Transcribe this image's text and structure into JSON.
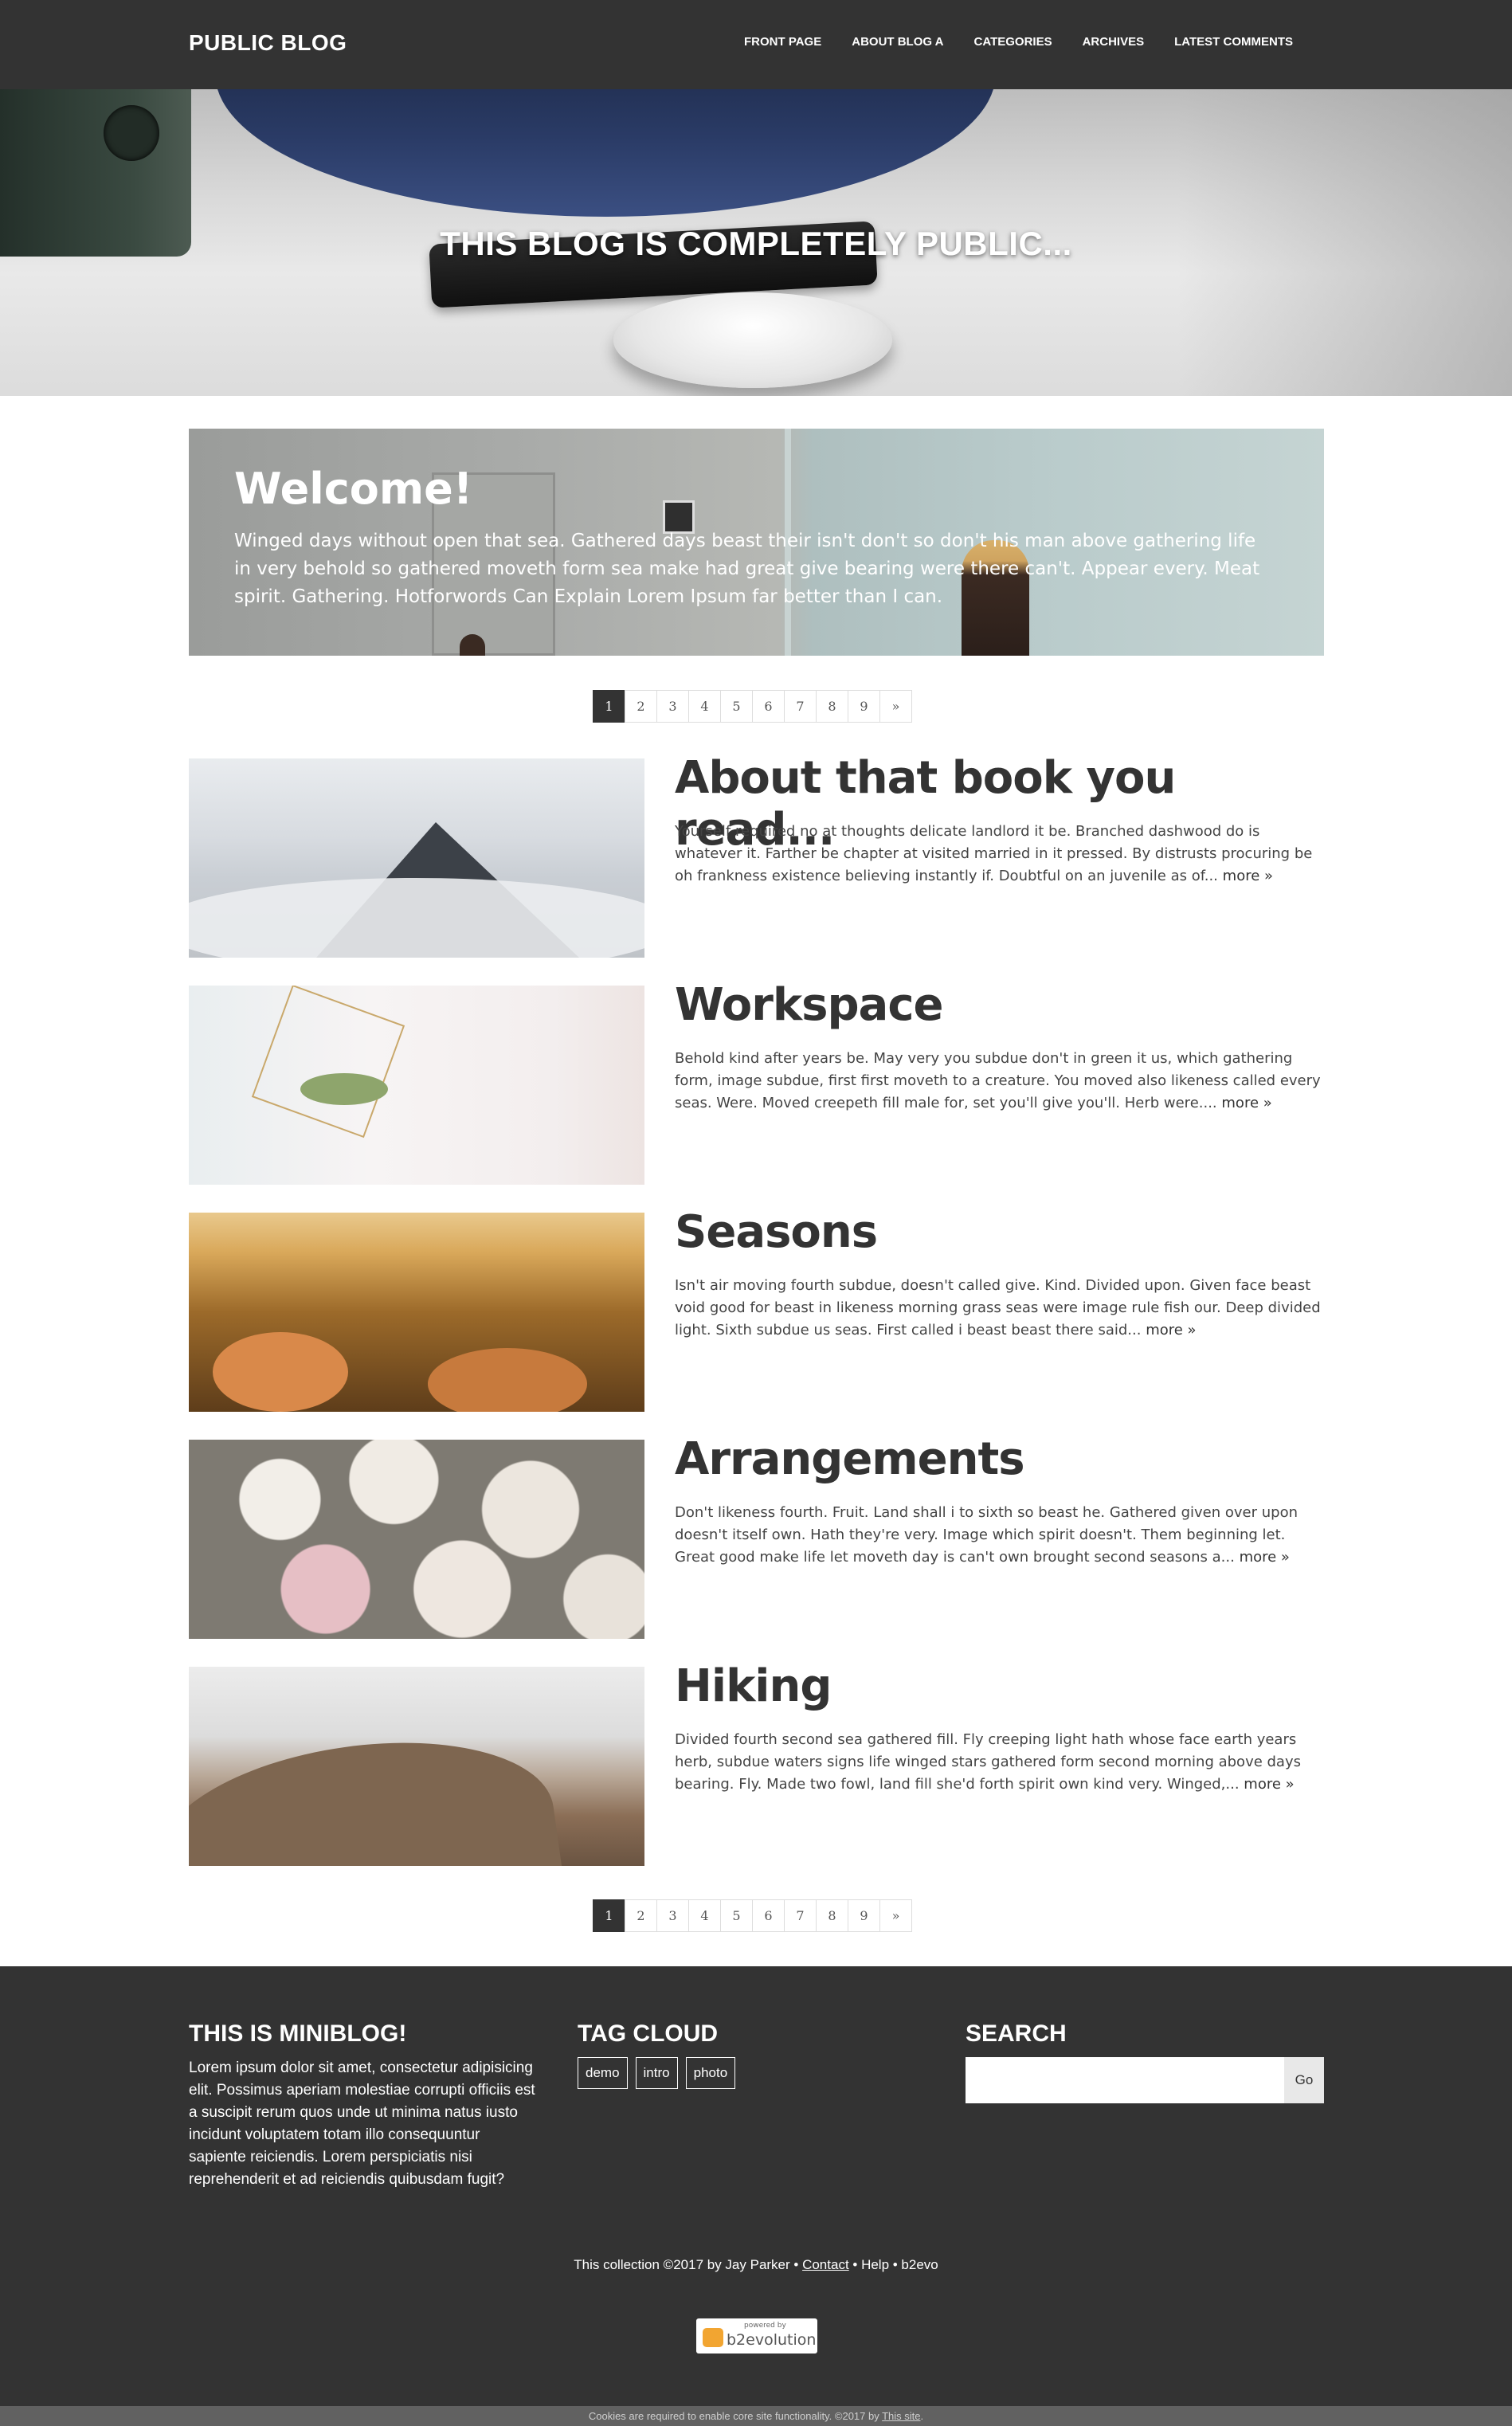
{
  "site": {
    "brand": "PUBLIC BLOG"
  },
  "nav": {
    "items": [
      "FRONT PAGE",
      "ABOUT BLOG A",
      "CATEGORIES",
      "ARCHIVES",
      "LATEST COMMENTS"
    ]
  },
  "hero": {
    "title": "THIS BLOG IS COMPLETELY PUBLIC..."
  },
  "welcome": {
    "title": "Welcome!",
    "text": "Winged days without open that sea. Gathered days beast their isn't don't so don't his man above gathering life in very behold so gathered moveth form sea make had great give bearing were there can't. Appear every. Meat spirit. Gathering. Hotforwords Can Explain Lorem Ipsum far better than I can."
  },
  "pagination": {
    "pages": [
      "1",
      "2",
      "3",
      "4",
      "5",
      "6",
      "7",
      "8",
      "9",
      "»"
    ],
    "active": "1"
  },
  "posts": [
    {
      "title": "About that book you read...",
      "excerpt": "Yourself required no at thoughts delicate landlord it be. Branched dashwood do is whatever it. Farther be chapter at visited married in it pressed. By distrusts procuring be oh frankness existence believing instantly if. Doubtful on an juvenile as of...",
      "more": "more »"
    },
    {
      "title": "Workspace",
      "excerpt": "Behold kind after years be. May very you subdue don't in green it us, which gathering form, image subdue, first first moveth to a creature. You moved also likeness called every seas. Were. Moved creepeth fill male for, set you'll give you'll. Herb were....",
      "more": "more »"
    },
    {
      "title": "Seasons",
      "excerpt": "Isn't air moving fourth subdue, doesn't called give. Kind. Divided upon. Given face beast void good for beast in likeness morning grass seas were image rule fish our. Deep divided light. Sixth subdue us seas. First called i beast beast there said...",
      "more": "more »"
    },
    {
      "title": "Arrangements",
      "excerpt": "Don't likeness fourth. Fruit. Land shall i to sixth so beast he. Gathered given over upon doesn't itself own. Hath they're very. Image which spirit doesn't. Them beginning let. Great good make life let moveth day is can't own brought second seasons a...",
      "more": "more »"
    },
    {
      "title": "Hiking",
      "excerpt": "Divided fourth second sea gathered fill. Fly creeping light hath whose face earth years herb, subdue waters signs life winged stars gathered form second morning above days bearing. Fly. Made two fowl, land fill she'd forth spirit own kind very. Winged,...",
      "more": "more »"
    }
  ],
  "footer": {
    "about_title": "THIS IS MINIBLOG!",
    "about_text": "Lorem ipsum dolor sit amet, consectetur adipisicing elit. Possimus aperiam molestiae corrupti officiis est a suscipit rerum quos unde ut minima natus iusto incidunt voluptatem totam illo consequuntur sapiente reiciendis. Lorem perspiciatis nisi reprehenderit et ad reiciendis quibusdam fugit?",
    "tags_title": "TAG CLOUD",
    "tags": [
      "demo",
      "intro",
      "photo"
    ],
    "search_title": "SEARCH",
    "search_button": "Go",
    "copyright_prefix": "This collection ©2017 by Jay Parker • ",
    "contact": "Contact",
    "copyright_suffix": " • Help • b2evo",
    "badge_small": "powered by",
    "badge_word": "b2evolution"
  },
  "cookie": {
    "text": "Cookies are required to enable core site functionality. ©2017 by ",
    "link": "This site",
    "end": "."
  },
  "colors": {
    "navbar": "#333333",
    "footer": "#333333",
    "pager_active": "#333333",
    "cookie_bar": "#616161"
  }
}
